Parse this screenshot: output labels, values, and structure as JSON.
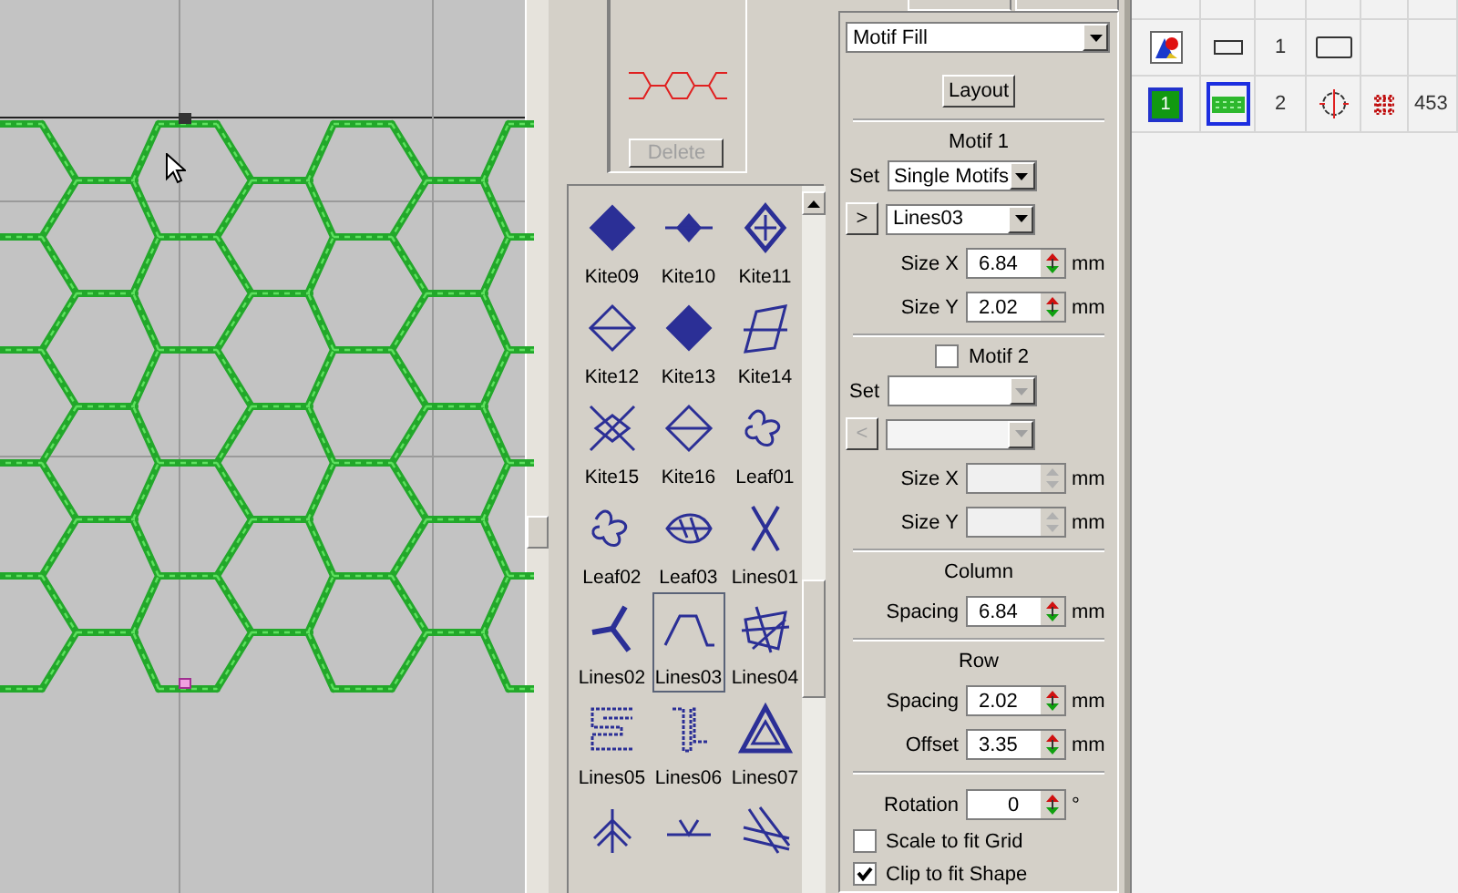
{
  "fill_type": {
    "value": "Motif Fill"
  },
  "delete_button": {
    "label": "Delete",
    "disabled": true
  },
  "motif_library": [
    {
      "name": "Kite09",
      "kind": "filled-diamond",
      "selected": false
    },
    {
      "name": "Kite10",
      "kind": "spiky-diamond",
      "selected": false
    },
    {
      "name": "Kite11",
      "kind": "outlined-diamond",
      "selected": false
    },
    {
      "name": "Kite12",
      "kind": "split-diamond",
      "selected": false
    },
    {
      "name": "Kite13",
      "kind": "filled-diamond",
      "selected": false
    },
    {
      "name": "Kite14",
      "kind": "parallelogram",
      "selected": false
    },
    {
      "name": "Kite15",
      "kind": "crossed-diamond",
      "selected": false
    },
    {
      "name": "Kite16",
      "kind": "split-diamond",
      "selected": false
    },
    {
      "name": "Leaf01",
      "kind": "squiggle",
      "selected": false
    },
    {
      "name": "Leaf02",
      "kind": "squiggle",
      "selected": false
    },
    {
      "name": "Leaf03",
      "kind": "leaf",
      "selected": false
    },
    {
      "name": "Lines01",
      "kind": "cross-lines",
      "selected": false
    },
    {
      "name": "Lines02",
      "kind": "tripod",
      "selected": false
    },
    {
      "name": "Lines03",
      "kind": "wave",
      "selected": true
    },
    {
      "name": "Lines04",
      "kind": "tangle",
      "selected": false
    },
    {
      "name": "Lines05",
      "kind": "spiral-square",
      "selected": false
    },
    {
      "name": "Lines06",
      "kind": "steps",
      "selected": false
    },
    {
      "name": "Lines07",
      "kind": "triangle",
      "selected": false
    },
    {
      "kind": "feather",
      "selected": false
    },
    {
      "kind": "flat-line",
      "selected": false
    },
    {
      "kind": "hash",
      "selected": false
    }
  ],
  "layout_button": {
    "label": "Layout"
  },
  "motif_1": {
    "title": "Motif 1",
    "set_label": "Set",
    "set_value": "Single Motifs",
    "arrow_button": ">",
    "motif_value": "Lines03",
    "fields": [
      {
        "label": "Size X",
        "value": "6.84",
        "unit": "mm"
      },
      {
        "label": "Size Y",
        "value": "2.02",
        "unit": "mm"
      }
    ]
  },
  "motif_2": {
    "title": "Motif 2",
    "checked": false,
    "set_label": "Set",
    "arrow_button": "<",
    "disabled": true,
    "fields": [
      {
        "label": "Size X",
        "unit": "mm"
      },
      {
        "label": "Size Y",
        "unit": "mm"
      }
    ]
  },
  "column": {
    "title": "Column",
    "fields": [
      {
        "label": "Spacing",
        "value": "6.84",
        "unit": "mm"
      }
    ]
  },
  "row": {
    "title": "Row",
    "fields": [
      {
        "label": "Spacing",
        "value": "2.02",
        "unit": "mm"
      },
      {
        "label": "Offset",
        "value": "3.35",
        "unit": "mm"
      }
    ]
  },
  "rotation": {
    "label": "Rotation",
    "value": "0",
    "unit": "°"
  },
  "options": [
    {
      "label": "Scale to fit Grid",
      "checked": false
    },
    {
      "label": "Clip to fit Shape",
      "checked": true
    }
  ],
  "objects": [
    {
      "kind": "group",
      "order": "1",
      "selected": false
    },
    {
      "kind": "fill",
      "badge": "1",
      "order": "2",
      "stitches": "453",
      "selected": true
    }
  ]
}
